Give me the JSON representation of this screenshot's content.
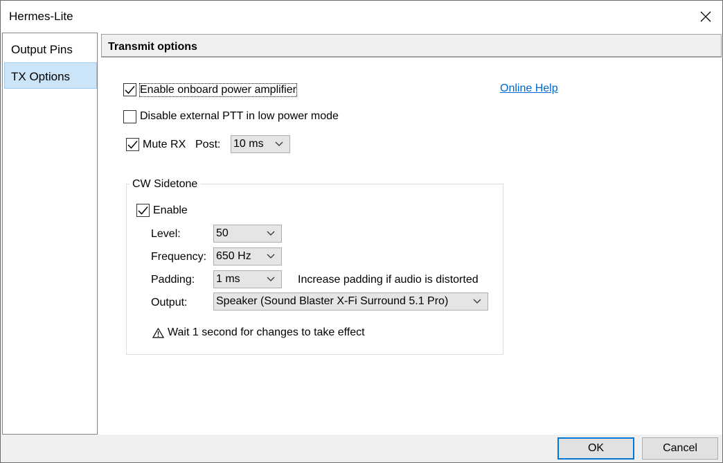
{
  "window": {
    "title": "Hermes-Lite"
  },
  "sidebar": {
    "items": [
      {
        "label": "Output Pins",
        "selected": false
      },
      {
        "label": "TX Options",
        "selected": true
      }
    ]
  },
  "main": {
    "section_title": "Transmit options",
    "online_help": "Online Help",
    "enable_pa": {
      "label": "Enable onboard power amplifier",
      "checked": true
    },
    "disable_ptt": {
      "label": "Disable external PTT in low power mode",
      "checked": false
    },
    "mute_rx": {
      "label": "Mute RX",
      "checked": true
    },
    "post": {
      "label": "Post:",
      "value": "10 ms"
    },
    "cw_sidetone": {
      "title": "CW Sidetone",
      "enable": {
        "label": "Enable",
        "checked": true
      },
      "level": {
        "label": "Level:",
        "value": "50"
      },
      "frequency": {
        "label": "Frequency:",
        "value": "650 Hz"
      },
      "padding": {
        "label": "Padding:",
        "value": "1 ms",
        "hint": "Increase padding if audio is distorted"
      },
      "output": {
        "label": "Output:",
        "value": "Speaker (Sound Blaster X-Fi Surround 5.1 Pro)"
      },
      "warning": "Wait 1 second for changes to take effect"
    }
  },
  "footer": {
    "ok_label": "OK",
    "cancel_label": "Cancel"
  },
  "colors": {
    "accent": "#0078d7",
    "link": "#0066cc",
    "selection": "#cce4f7"
  }
}
